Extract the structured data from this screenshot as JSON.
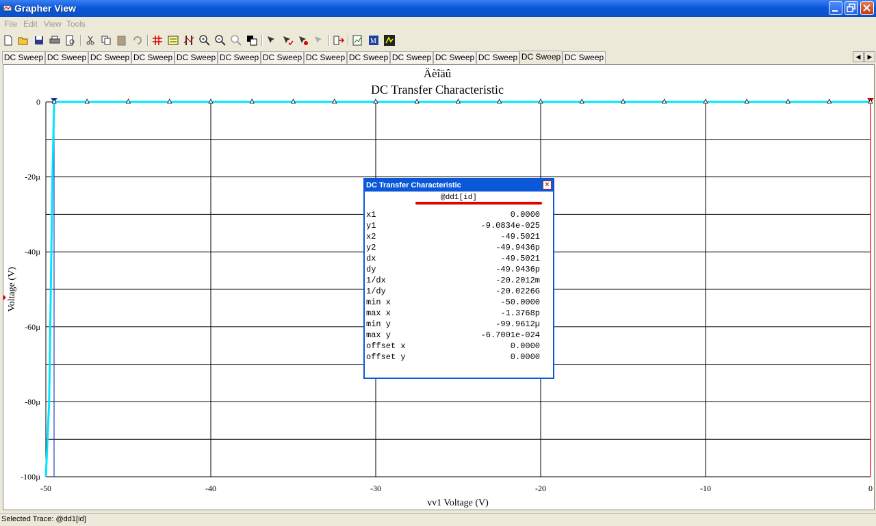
{
  "window": {
    "title": "Grapher View"
  },
  "menu": [
    "File",
    "Edit",
    "View",
    "Tools"
  ],
  "tabs": [
    "DC Sweep",
    "DC Sweep",
    "DC Sweep",
    "DC Sweep",
    "DC Sweep",
    "DC Sweep",
    "DC Sweep",
    "DC Sweep",
    "DC Sweep",
    "DC Sweep",
    "DC Sweep",
    "DC Sweep",
    "DC Sweep",
    "DC Sweep"
  ],
  "active_tab_index": 12,
  "toolbar_icons": [
    "new-icon",
    "open-icon",
    "save-icon",
    "print-icon",
    "print-preview-icon",
    "cut-icon",
    "copy-icon",
    "paste-icon",
    "undo-icon",
    "grid-icon",
    "legend-icon",
    "cursors-icon",
    "zoom-in-icon",
    "zoom-out-icon",
    "zoom-full-icon",
    "reverse-colors-icon",
    "select-marks-icon",
    "add-mark-icon",
    "remove-mark-icon",
    "mark-properties-icon",
    "export-icon",
    "excel-icon",
    "mathcad-icon",
    "overlay-icon"
  ],
  "chart_data": {
    "type": "line",
    "title_line1": "Äèîäû",
    "title": "DC Transfer Characteristic",
    "xlabel": "vv1 Voltage (V)",
    "ylabel": "Voltage (V)",
    "xlim": [
      -50,
      0
    ],
    "ylim": [
      -100,
      0
    ],
    "y_unit": "µ",
    "x_ticks": [
      "-50",
      "-40",
      "-30",
      "-20",
      "-10",
      "0"
    ],
    "y_ticks": [
      "0",
      "-20µ",
      "-40µ",
      "-60µ",
      "-80µ",
      "-100µ"
    ],
    "grid": true,
    "series": [
      {
        "name": "@dd1[id]",
        "color": "#00e5ff",
        "x": [
          -50,
          -49.8,
          -49.6,
          -49.5,
          -47.5,
          -45,
          -42.5,
          -40,
          -37.5,
          -35,
          -32.5,
          -30,
          -27.5,
          -25,
          -22.5,
          -20,
          -17.5,
          -15,
          -12.5,
          -10,
          -7.5,
          -5,
          -2.5,
          0
        ],
        "y": [
          -99.9612,
          -80,
          -20,
          -5e-05,
          0,
          0,
          0,
          0,
          0,
          0,
          0,
          0,
          0,
          0,
          0,
          0,
          0,
          0,
          0,
          0,
          0,
          0,
          0,
          0
        ]
      }
    ],
    "cursors": [
      {
        "x": -49.5021,
        "color": "#2040c0"
      },
      {
        "x": 0.0,
        "color": "#e00000"
      }
    ]
  },
  "cursor_window": {
    "title": "DC Transfer Characteristic",
    "trace": "@dd1[id]",
    "rows": [
      {
        "k": "x1",
        "v": "0.0000"
      },
      {
        "k": "y1",
        "v": "-9.0834e-025"
      },
      {
        "k": "x2",
        "v": "-49.5021"
      },
      {
        "k": "y2",
        "v": "-49.9436p"
      },
      {
        "k": "dx",
        "v": "-49.5021"
      },
      {
        "k": "dy",
        "v": "-49.9436p"
      },
      {
        "k": "1/dx",
        "v": "-20.2012m"
      },
      {
        "k": "1/dy",
        "v": "-20.0226G"
      },
      {
        "k": "min x",
        "v": "-50.0000"
      },
      {
        "k": "max x",
        "v": "-1.3768p"
      },
      {
        "k": "min y",
        "v": "-99.9612µ"
      },
      {
        "k": "max y",
        "v": "-6.7001e-024"
      },
      {
        "k": "offset x",
        "v": "0.0000"
      },
      {
        "k": "offset y",
        "v": "0.0000"
      }
    ]
  },
  "status": {
    "selected_trace": "Selected Trace:  @dd1[id]"
  }
}
